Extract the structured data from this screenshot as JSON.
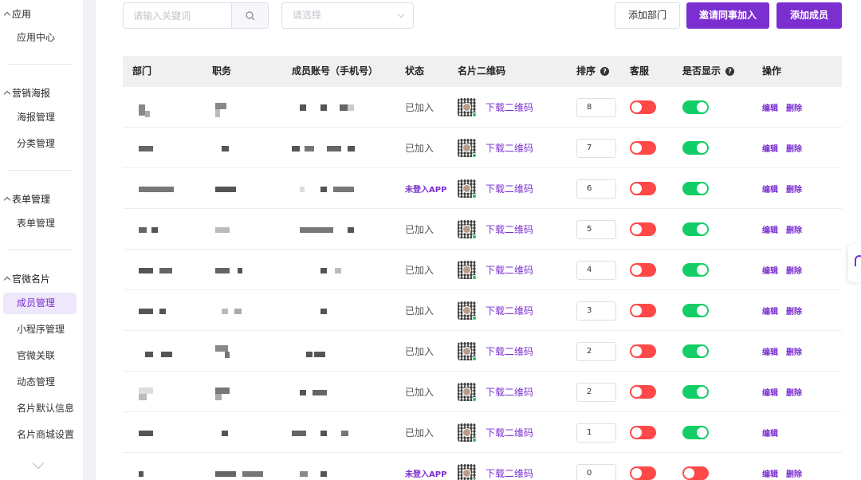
{
  "sidebar": {
    "groups": [
      {
        "title": "应用",
        "items": [
          {
            "label": "应用中心"
          }
        ]
      },
      {
        "title": "营销海报",
        "items": [
          {
            "label": "海报管理"
          },
          {
            "label": "分类管理"
          }
        ]
      },
      {
        "title": "表单管理",
        "items": [
          {
            "label": "表单管理"
          }
        ]
      },
      {
        "title": "官微名片",
        "items": [
          {
            "label": "成员管理",
            "active": true
          },
          {
            "label": "小程序管理"
          },
          {
            "label": "官微关联"
          },
          {
            "label": "动态管理"
          },
          {
            "label": "名片默认信息"
          },
          {
            "label": "名片商城设置"
          }
        ]
      }
    ]
  },
  "toolbar": {
    "search_placeholder": "请输入关键词",
    "select_placeholder": "请选择",
    "add_dept_label": "添加部门",
    "invite_label": "邀请同事加入",
    "add_member_label": "添加成员"
  },
  "table": {
    "headers": {
      "dept": "部门",
      "position": "职务",
      "account": "成员账号（手机号）",
      "status": "状态",
      "qrcode": "名片二维码",
      "sort": "排序",
      "service": "客服",
      "display": "是否显示",
      "actions": "操作"
    },
    "download_label": "下载二维码",
    "edit_label": "编辑",
    "delete_label": "删除",
    "rows": [
      {
        "status": "已加入",
        "sort": "8",
        "service": false,
        "display": true,
        "delete": true
      },
      {
        "status": "已加入",
        "sort": "7",
        "service": false,
        "display": true,
        "delete": true
      },
      {
        "status": "未登入APP",
        "sort": "6",
        "service": false,
        "display": true,
        "delete": true
      },
      {
        "status": "已加入",
        "sort": "5",
        "service": false,
        "display": true,
        "delete": true
      },
      {
        "status": "已加入",
        "sort": "4",
        "service": false,
        "display": true,
        "delete": true
      },
      {
        "status": "已加入",
        "sort": "3",
        "service": false,
        "display": true,
        "delete": true
      },
      {
        "status": "已加入",
        "sort": "2",
        "service": false,
        "display": true,
        "delete": true
      },
      {
        "status": "已加入",
        "sort": "2",
        "service": false,
        "display": true,
        "delete": true
      },
      {
        "status": "已加入",
        "sort": "1",
        "service": false,
        "display": true,
        "delete": false
      },
      {
        "status": "未登入APP",
        "sort": "0",
        "service": false,
        "display": false,
        "delete": true
      }
    ]
  },
  "colors": {
    "accent": "#7b2fd0",
    "toggle_on": "#13ce66",
    "toggle_off": "#ff4949"
  }
}
